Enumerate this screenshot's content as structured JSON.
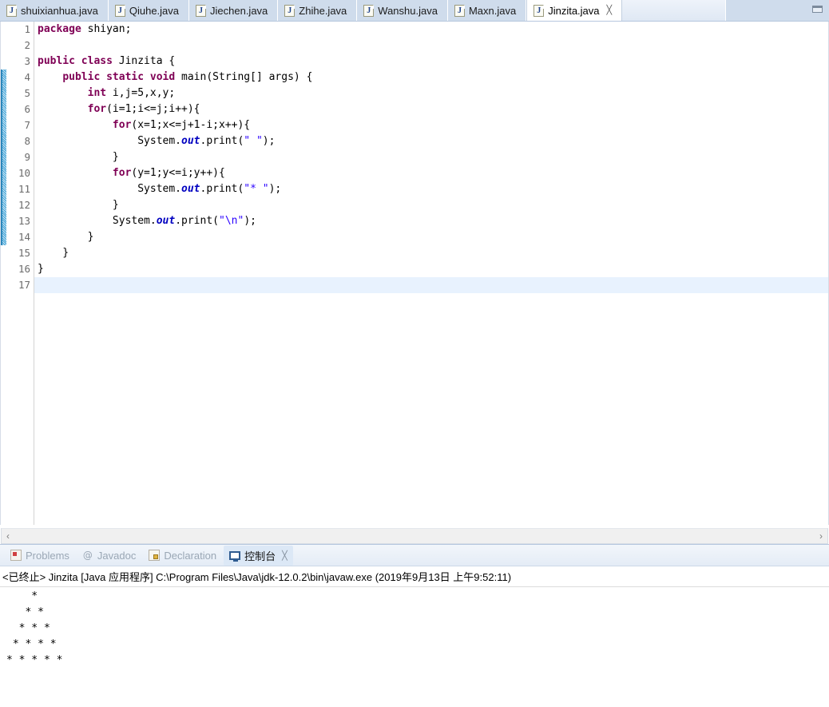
{
  "window": {
    "minimize_icon": "minimize-restore-icon"
  },
  "editor_tabs": [
    {
      "label": "shuixianhua.java",
      "icon": "java-file-icon",
      "active": false
    },
    {
      "label": "Qiuhe.java",
      "icon": "java-file-icon",
      "active": false
    },
    {
      "label": "Jiechen.java",
      "icon": "java-file-icon",
      "active": false
    },
    {
      "label": "Zhihe.java",
      "icon": "java-file-icon",
      "active": false
    },
    {
      "label": "Wanshu.java",
      "icon": "java-file-icon",
      "active": false
    },
    {
      "label": "Maxn.java",
      "icon": "java-file-icon",
      "active": false
    },
    {
      "label": "Jinzita.java",
      "icon": "java-file-icon",
      "active": true,
      "close": "╳"
    }
  ],
  "editor": {
    "line_numbers": [
      "1",
      "2",
      "3",
      "4",
      "5",
      "6",
      "7",
      "8",
      "9",
      "10",
      "11",
      "12",
      "13",
      "14",
      "15",
      "16",
      "17"
    ],
    "fold_marker_line": 4,
    "current_line": 17,
    "lines": [
      {
        "n": 1,
        "tokens": [
          {
            "t": "kw",
            "v": "package"
          },
          {
            "t": "pln",
            "v": " shiyan;"
          }
        ]
      },
      {
        "n": 2,
        "tokens": []
      },
      {
        "n": 3,
        "tokens": [
          {
            "t": "kw",
            "v": "public class"
          },
          {
            "t": "pln",
            "v": " Jinzita {"
          }
        ]
      },
      {
        "n": 4,
        "tokens": [
          {
            "t": "pln",
            "v": "    "
          },
          {
            "t": "kw",
            "v": "public static void"
          },
          {
            "t": "pln",
            "v": " main(String[] args) {"
          }
        ]
      },
      {
        "n": 5,
        "tokens": [
          {
            "t": "pln",
            "v": "        "
          },
          {
            "t": "kw",
            "v": "int"
          },
          {
            "t": "pln",
            "v": " i,j=5,x,y;"
          }
        ]
      },
      {
        "n": 6,
        "tokens": [
          {
            "t": "pln",
            "v": "        "
          },
          {
            "t": "kw",
            "v": "for"
          },
          {
            "t": "pln",
            "v": "(i=1;i<=j;i++){"
          }
        ]
      },
      {
        "n": 7,
        "tokens": [
          {
            "t": "pln",
            "v": "            "
          },
          {
            "t": "kw",
            "v": "for"
          },
          {
            "t": "pln",
            "v": "(x=1;x<=j+1-i;x++){"
          }
        ]
      },
      {
        "n": 8,
        "tokens": [
          {
            "t": "pln",
            "v": "                System."
          },
          {
            "t": "stat",
            "v": "out"
          },
          {
            "t": "pln",
            "v": ".print("
          },
          {
            "t": "str",
            "v": "\" \""
          },
          {
            "t": "pln",
            "v": ");"
          }
        ]
      },
      {
        "n": 9,
        "tokens": [
          {
            "t": "pln",
            "v": "            }"
          }
        ]
      },
      {
        "n": 10,
        "tokens": [
          {
            "t": "pln",
            "v": "            "
          },
          {
            "t": "kw",
            "v": "for"
          },
          {
            "t": "pln",
            "v": "(y=1;y<=i;y++){"
          }
        ]
      },
      {
        "n": 11,
        "tokens": [
          {
            "t": "pln",
            "v": "                System."
          },
          {
            "t": "stat",
            "v": "out"
          },
          {
            "t": "pln",
            "v": ".print("
          },
          {
            "t": "str",
            "v": "\"* \""
          },
          {
            "t": "pln",
            "v": ");"
          }
        ]
      },
      {
        "n": 12,
        "tokens": [
          {
            "t": "pln",
            "v": "            }"
          }
        ]
      },
      {
        "n": 13,
        "tokens": [
          {
            "t": "pln",
            "v": "            System."
          },
          {
            "t": "stat",
            "v": "out"
          },
          {
            "t": "pln",
            "v": ".print("
          },
          {
            "t": "str",
            "v": "\"\\n\""
          },
          {
            "t": "pln",
            "v": ");"
          }
        ]
      },
      {
        "n": 14,
        "tokens": [
          {
            "t": "pln",
            "v": "        }"
          }
        ]
      },
      {
        "n": 15,
        "tokens": [
          {
            "t": "pln",
            "v": "    }"
          }
        ]
      },
      {
        "n": 16,
        "tokens": [
          {
            "t": "pln",
            "v": "}"
          }
        ]
      },
      {
        "n": 17,
        "tokens": []
      }
    ]
  },
  "scrollbar": {
    "left_arrow": "‹",
    "right_arrow": "›"
  },
  "view_tabs": [
    {
      "label": "Problems",
      "icon": "problems-icon",
      "active": false
    },
    {
      "label": "Javadoc",
      "icon": "javadoc-icon",
      "active": false
    },
    {
      "label": "Declaration",
      "icon": "declaration-icon",
      "active": false
    },
    {
      "label": "控制台",
      "icon": "console-icon",
      "active": true,
      "close": "╳"
    }
  ],
  "console": {
    "status": "<已终止> Jinzita [Java 应用程序] C:\\Program Files\\Java\\jdk-12.0.2\\bin\\javaw.exe  (2019年9月13日 上午9:52:11)",
    "output": "    *\n   * *\n  * * *\n * * * *\n* * * * *"
  },
  "colors": {
    "keyword": "#7f0055",
    "string": "#2a00ff",
    "static_field": "#0000c0",
    "tab_inactive": "#cfdcec",
    "tab_active": "#ffffff",
    "current_line": "#e8f2fe",
    "change_bar": "#2b86bb"
  }
}
